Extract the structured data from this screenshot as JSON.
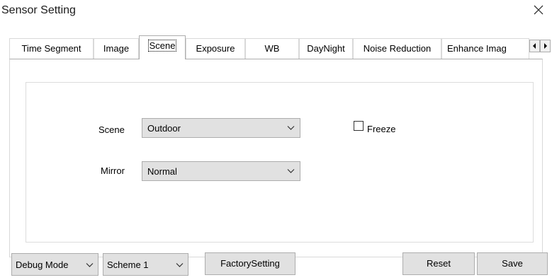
{
  "window": {
    "title": "Sensor Setting"
  },
  "tabs": [
    {
      "label": "Time Segment"
    },
    {
      "label": "Image"
    },
    {
      "label": "Scene"
    },
    {
      "label": "Exposure"
    },
    {
      "label": "WB"
    },
    {
      "label": "DayNight"
    },
    {
      "label": "Noise Reduction"
    },
    {
      "label": "Enhance Imag"
    }
  ],
  "active_tab": "Scene",
  "scene_form": {
    "scene_label": "Scene",
    "scene_value": "Outdoor",
    "mirror_label": "Mirror",
    "mirror_value": "Normal",
    "freeze_label": "Freeze",
    "freeze_checked": false
  },
  "footer": {
    "debug_mode_value": "Debug Mode",
    "scheme_value": "Scheme 1",
    "factory_setting_label": "FactorySetting",
    "reset_label": "Reset",
    "save_label": "Save"
  },
  "icons": {
    "close": "close-icon",
    "chevron": "chevron-down-icon",
    "scroll_left": "scroll-left-icon",
    "scroll_right": "scroll-right-icon"
  }
}
